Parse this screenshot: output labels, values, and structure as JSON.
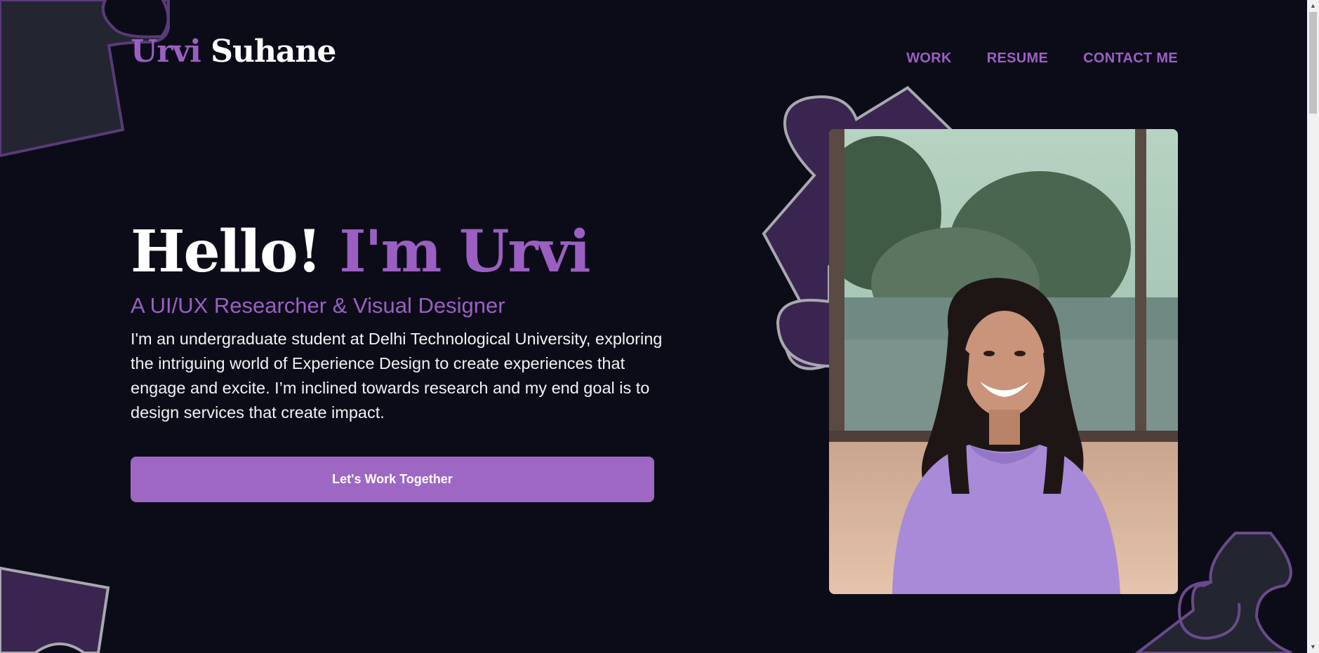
{
  "header": {
    "logo_first": "Urvi",
    "logo_last": "Suhane",
    "nav": [
      {
        "label": "WORK"
      },
      {
        "label": "RESUME"
      },
      {
        "label": "CONTACT ME"
      }
    ]
  },
  "hero": {
    "greeting": "Hello!",
    "name": "I'm Urvi",
    "subtitle": "A UI/UX Researcher & Visual Designer",
    "bio": "I'm an undergraduate student at Delhi Technological University, exploring the intriguing world of Experience Design to create experiences that engage and excite. I’m inclined towards research and my end goal is to design services that create impact.",
    "cta_label": "Let's Work Together"
  },
  "colors": {
    "background": "#0b0c18",
    "accent": "#9b5fc2",
    "button": "#9e67c4",
    "puzzle_purple": "#3a2550",
    "puzzle_dark": "#232531"
  },
  "icons": {
    "scroll_up": "▲",
    "scroll_down": "▼"
  }
}
